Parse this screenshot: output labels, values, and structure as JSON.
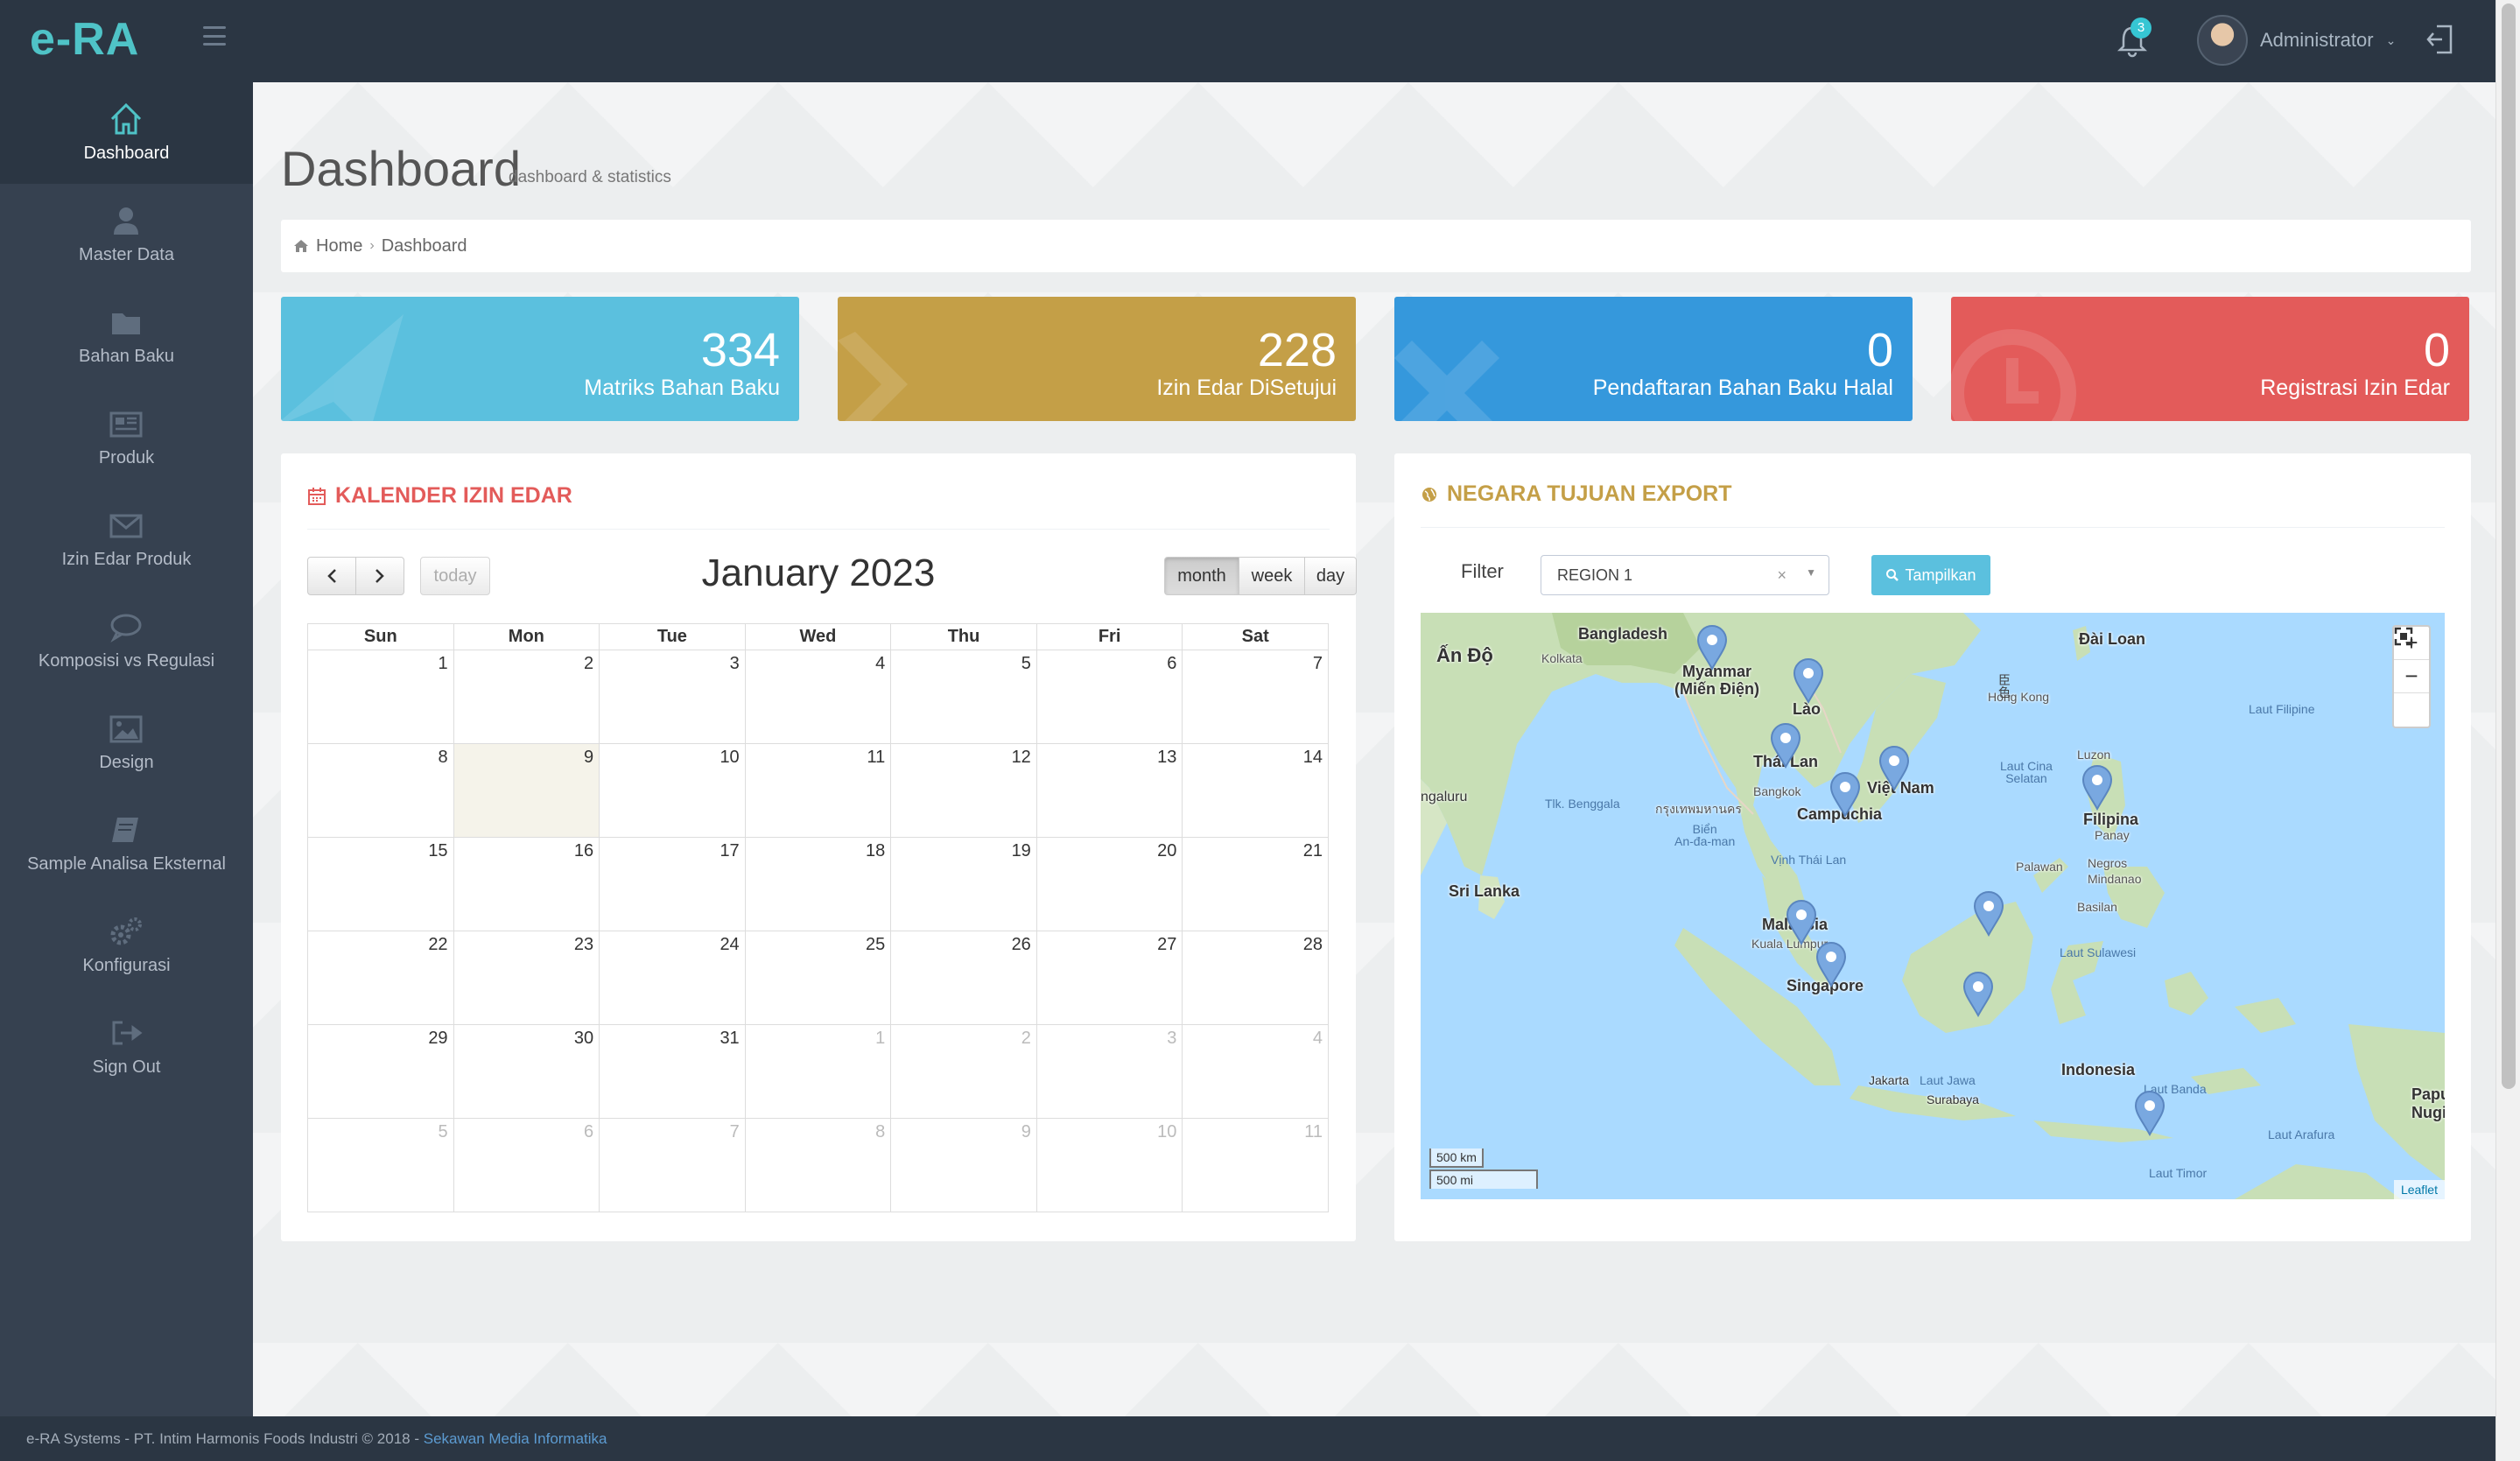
{
  "header": {
    "logo_text": "e-RA",
    "notification_count": "3",
    "user_name": "Administrator"
  },
  "sidebar": {
    "items": [
      {
        "label": "Dashboard",
        "icon": "home-icon"
      },
      {
        "label": "Master Data",
        "icon": "user-icon"
      },
      {
        "label": "Bahan Baku",
        "icon": "folder-icon"
      },
      {
        "label": "Produk",
        "icon": "newspaper-icon"
      },
      {
        "label": "Izin Edar Produk",
        "icon": "envelope-icon"
      },
      {
        "label": "Komposisi vs Regulasi",
        "icon": "comment-icon"
      },
      {
        "label": "Design",
        "icon": "image-icon"
      },
      {
        "label": "Sample Analisa Eksternal",
        "icon": "book-icon"
      },
      {
        "label": "Konfigurasi",
        "icon": "gears-icon"
      },
      {
        "label": "Sign Out",
        "icon": "sign-out-icon"
      }
    ]
  },
  "page": {
    "title": "Dashboard",
    "subtitle": "dashboard & statistics",
    "breadcrumb": {
      "home": "Home",
      "current": "Dashboard"
    }
  },
  "stats": [
    {
      "value": "334",
      "label": "Matriks Bahan Baku",
      "color": "#5bc0de"
    },
    {
      "value": "228",
      "label": "Izin Edar DiSetujui",
      "color": "#c49f47"
    },
    {
      "value": "0",
      "label": "Pendaftaran Bahan Baku Halal",
      "color": "#3598dc"
    },
    {
      "value": "0",
      "label": "Registrasi Izin Edar",
      "color": "#e35b5a"
    }
  ],
  "calendar": {
    "title": "KALENDER IZIN EDAR",
    "month_label": "January 2023",
    "today_label": "today",
    "views": {
      "month": "month",
      "week": "week",
      "day": "day"
    },
    "weekdays": [
      "Sun",
      "Mon",
      "Tue",
      "Wed",
      "Thu",
      "Fri",
      "Sat"
    ],
    "weeks": [
      [
        "1",
        "2",
        "3",
        "4",
        "5",
        "6",
        "7"
      ],
      [
        "8",
        "9",
        "10",
        "11",
        "12",
        "13",
        "14"
      ],
      [
        "15",
        "16",
        "17",
        "18",
        "19",
        "20",
        "21"
      ],
      [
        "22",
        "23",
        "24",
        "25",
        "26",
        "27",
        "28"
      ],
      [
        "29",
        "30",
        "31",
        "1",
        "2",
        "3",
        "4"
      ],
      [
        "5",
        "6",
        "7",
        "8",
        "9",
        "10",
        "11"
      ]
    ],
    "today_cell": [
      1,
      1
    ],
    "other_month_from": [
      4,
      3
    ]
  },
  "export_map": {
    "title": "NEGARA TUJUAN EXPORT",
    "filter_label": "Filter",
    "filter_value": "REGION 1",
    "show_button": "Tampilkan",
    "zoom_in": "+",
    "zoom_out": "−",
    "scale_km": "500 km",
    "scale_mi": "500 mi",
    "attribution": "Leaflet",
    "place_labels": {
      "an_do": "Ấn Độ",
      "bangladesh": "Bangladesh",
      "kolkata": "Kolkata",
      "myanmar": "Myanmar\n(Miến Điện)",
      "dai_loan": "Đài Loan",
      "hong_kong": "Hong Kong",
      "lao": "Lào",
      "thai_lan": "Thái Lan",
      "viet_nam": "Việt Nam",
      "bangkok": "Bangkok",
      "krung_thep": "กรุงเทพมหานคร",
      "campuchia": "Campuchia",
      "filipina": "Filipina",
      "luzon": "Luzon",
      "sri_lanka": "Sri Lanka",
      "bengaluru": "ngaluru",
      "malaysia": "Malaysia",
      "kuala_lumpur": "Kuala Lumpur",
      "singapore": "Singapore",
      "indonesia": "Indonesia",
      "jakarta": "Jakarta",
      "surabaya": "Surabaya",
      "papua": "Papua\nNugini",
      "panay": "Panay",
      "negros": "Negros",
      "mindanao": "Mindanao",
      "palawan": "Palawan",
      "basilan": "Basilan"
    },
    "sea_labels": {
      "luat_filipine": "Laut Filipine",
      "laut_cina": "Laut Cina\nSelatan",
      "tlk_benggala": "Tlk. Benggala",
      "bien_andaman": "Biển\nAn-đa-man",
      "vinh_thai_lan": "Vịnh Thái Lan",
      "laut_sulawesi": "Laut Sulawesi",
      "laut_jawa": "Laut Jawa",
      "laut_banda": "Laut Banda",
      "laut_arafura": "Laut Arafura",
      "laut_timor": "Laut Timor",
      "kr": "臣\n色"
    },
    "markers": [
      "Myanmar",
      "Lao",
      "Thailand",
      "Vietnam",
      "Cambodia",
      "Philippines",
      "Malaysia",
      "Singapore",
      "Brunei",
      "Indonesia-Kalimantan",
      "Indonesia-Bali-NTT"
    ]
  },
  "footer": {
    "text": "e-RA Systems - PT. Intim Harmonis Foods Industri © 2018 - ",
    "link": "Sekawan Media Informatika"
  }
}
